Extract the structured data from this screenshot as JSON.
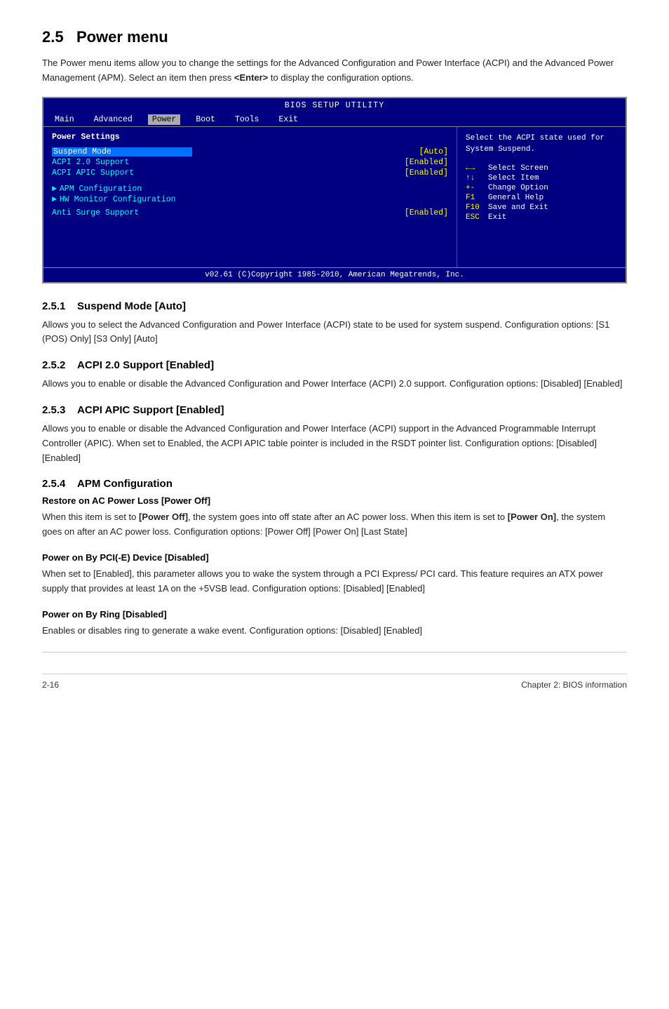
{
  "page": {
    "section_number": "2.5",
    "section_title": "Power menu",
    "intro": "The Power menu items allow you to change the settings for the Advanced Configuration and Power Interface (ACPI) and the Advanced Power Management (APM). Select an item then press ",
    "intro_bold": "<Enter>",
    "intro_end": " to display the configuration options."
  },
  "bios": {
    "title": "BIOS SETUP UTILITY",
    "menu_items": [
      {
        "label": "Main",
        "active": false
      },
      {
        "label": "Advanced",
        "active": false
      },
      {
        "label": "Power",
        "active": true
      },
      {
        "label": "Boot",
        "active": false
      },
      {
        "label": "Tools",
        "active": false
      },
      {
        "label": "Exit",
        "active": false
      }
    ],
    "section_header": "Power Settings",
    "items": [
      {
        "label": "Suspend Mode",
        "value": "[Auto]",
        "highlighted": true
      },
      {
        "label": "ACPI 2.0 Support",
        "value": "[Enabled]",
        "highlighted": false
      },
      {
        "label": "ACPI APIC Support",
        "value": "[Enabled]",
        "highlighted": false
      }
    ],
    "submenus": [
      {
        "label": "APM Configuration"
      },
      {
        "label": "HW Monitor Configuration"
      }
    ],
    "anti_surge": {
      "label": "Anti Surge Support",
      "value": "[Enabled]"
    },
    "help_text": "Select the ACPI state used for System Suspend.",
    "key_help": [
      {
        "key": "←→",
        "desc": "Select Screen"
      },
      {
        "key": "↑↓",
        "desc": "Select Item"
      },
      {
        "key": "+-",
        "desc": "Change Option"
      },
      {
        "key": "F1",
        "desc": "General Help"
      },
      {
        "key": "F10",
        "desc": "Save and Exit"
      },
      {
        "key": "ESC",
        "desc": "Exit"
      }
    ],
    "footer": "v02.61  (C)Copyright 1985-2010, American Megatrends, Inc."
  },
  "subsections": [
    {
      "number": "2.5.1",
      "title": "Suspend Mode [Auto]",
      "body": "Allows you to select the Advanced Configuration and Power Interface (ACPI) state to be used for system suspend. Configuration options: [S1 (POS) Only] [S3 Only] [Auto]"
    },
    {
      "number": "2.5.2",
      "title": "ACPI 2.0 Support [Enabled]",
      "body": "Allows you to enable or disable the Advanced Configuration and Power Interface (ACPI) 2.0 support. Configuration options: [Disabled] [Enabled]"
    },
    {
      "number": "2.5.3",
      "title": "ACPI APIC Support [Enabled]",
      "body": "Allows you to enable or disable the Advanced Configuration and Power Interface (ACPI) support in the Advanced Programmable Interrupt Controller (APIC). When set to Enabled, the ACPI APIC table pointer is included in the RSDT pointer list. Configuration options: [Disabled] [Enabled]"
    },
    {
      "number": "2.5.4",
      "title": "APM Configuration",
      "subheadings": [
        {
          "title": "Restore on AC Power Loss [Power Off]",
          "body_parts": [
            "When this item is set to ",
            "[Power Off]",
            ", the system goes into off state after an AC power loss. When this item is set to ",
            "[Power On]",
            ", the system goes on after an AC power loss. Configuration options: [Power Off] [Power On] [Last State]"
          ]
        },
        {
          "title": "Power on By PCI(-E) Device [Disabled]",
          "body": "When set to [Enabled], this parameter allows you to wake the system through a PCI Express/ PCI card. This feature requires an ATX power supply that provides at least 1A on the +5VSB lead. Configuration options: [Disabled] [Enabled]"
        },
        {
          "title": "Power on By Ring [Disabled]",
          "body": "Enables or disables ring to generate a wake event. Configuration options: [Disabled] [Enabled]"
        }
      ]
    }
  ],
  "footer": {
    "left": "2-16",
    "right": "Chapter 2: BIOS information"
  }
}
